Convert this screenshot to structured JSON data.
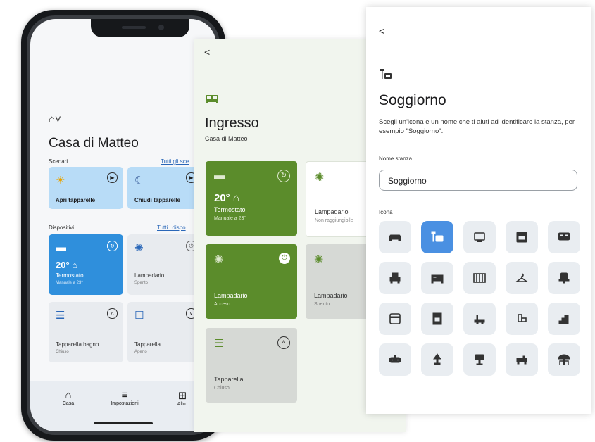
{
  "phone": {
    "home_title": "Casa di Matteo",
    "scenes": {
      "label": "Scenari",
      "link": "Tutti gli sce",
      "items": [
        {
          "label": "Apri tapparelle",
          "icon": "sun-icon"
        },
        {
          "label": "Chiudi tapparelle",
          "icon": "moon-icon"
        }
      ]
    },
    "devices": {
      "label": "Dispositivi",
      "link": "Tutti i dispo",
      "thermostat": {
        "temp": "20° ⌂",
        "name": "Termostato",
        "sub": "Manuale a 23°"
      },
      "chandelier": {
        "name": "Lampadario",
        "sub": "Spento"
      },
      "blind_bath": {
        "name": "Tapparella bagno",
        "sub": "Chiuso"
      },
      "blind": {
        "name": "Tapparella",
        "sub": "Aperto"
      }
    },
    "nav": [
      {
        "label": "Casa",
        "icon": "home-icon"
      },
      {
        "label": "Impostazioni",
        "icon": "sliders-icon"
      },
      {
        "label": "Altro",
        "icon": "grid-icon"
      }
    ]
  },
  "room": {
    "back": "<",
    "title": "Ingresso",
    "subtitle": "Casa di Matteo",
    "devices": {
      "thermostat": {
        "temp": "20° ⌂",
        "name": "Termostato",
        "sub": "Manuale a 23°"
      },
      "chandelier_unreach": {
        "name": "Lampadario",
        "sub": "Non raggiungibile"
      },
      "chandelier_on": {
        "name": "Lampadario",
        "sub": "Acceso"
      },
      "chandelier_off": {
        "name": "Lampadario",
        "sub": "Spento"
      },
      "blind": {
        "name": "Tapparella",
        "sub": "Chiuso"
      }
    }
  },
  "editor": {
    "back": "<",
    "title": "Soggiorno",
    "description": "Scegli un'icona e un nome che ti aiuti ad identificare la stanza, per esempio \"Soggiorno\".",
    "name_label": "Nome stanza",
    "name_value": "Soggiorno",
    "icon_label": "Icona",
    "icons": [
      "sofa-icon",
      "armchair-lamp-icon",
      "monitor-icon",
      "oven-icon",
      "cabinet-icon",
      "sofa-small-icon",
      "bed-icon",
      "crib-icon",
      "hanger-icon",
      "office-chair-icon",
      "microwave-icon",
      "fridge-icon",
      "bathtub-icon",
      "toilet-icon",
      "stairs-icon",
      "gamepad-icon",
      "table-lamp-icon",
      "sink-icon",
      "wardrobe-icon",
      "patio-umbrella-icon"
    ],
    "selected_index": 1
  },
  "colors": {
    "accent_blue": "#4a90e2",
    "tile_blue_light": "#b8dcf7",
    "tile_blue": "#2f8fdc",
    "green": "#5b8c2b",
    "green_light_bg": "#f1f5ee"
  }
}
